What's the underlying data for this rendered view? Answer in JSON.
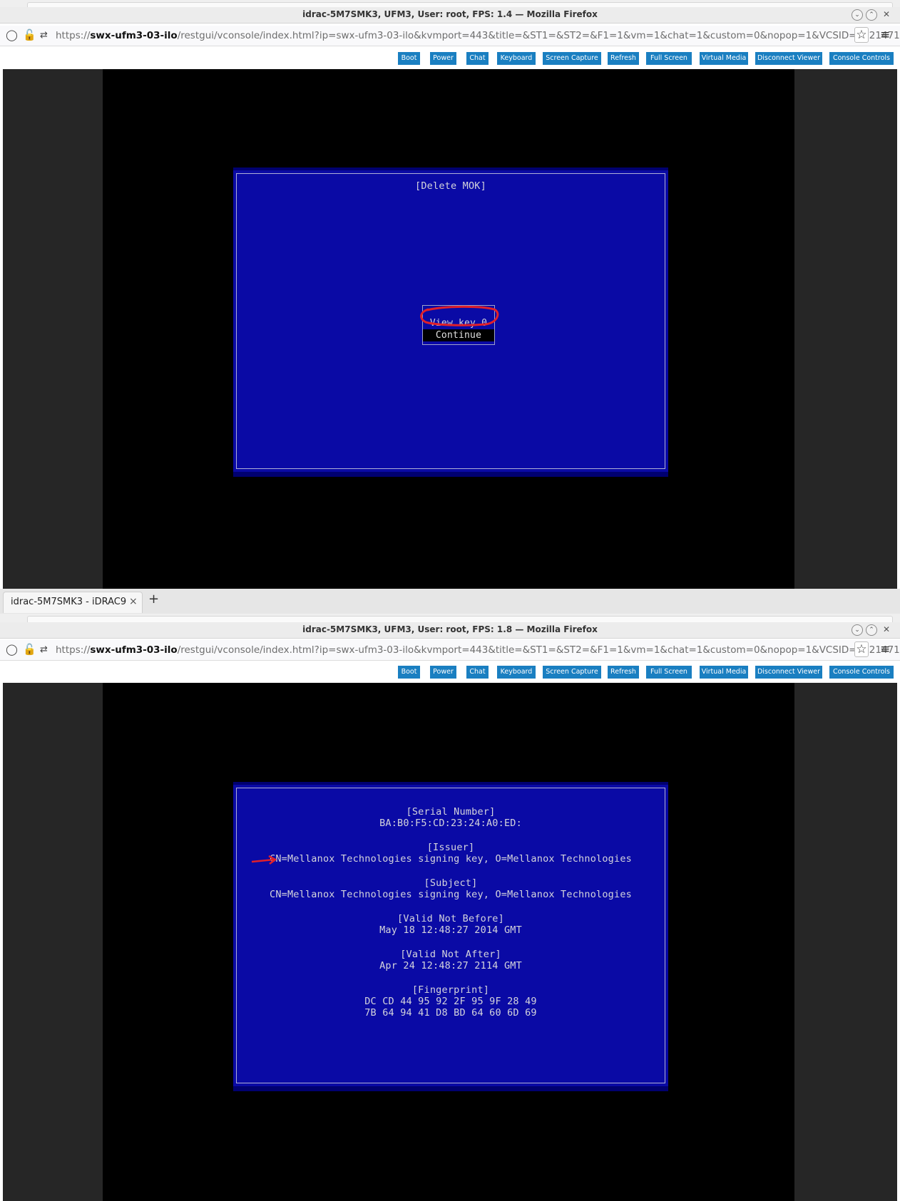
{
  "browser": {
    "tab": {
      "label": "idrac-5M7SMK3 - iDRAC9",
      "close": "×",
      "new_tab": "+"
    },
    "url": {
      "prefix": "https://",
      "domain": "swx-ufm3-03-ilo",
      "path": "/restgui/vconsole/index.html?ip=swx-ufm3-03-ilo&kvmport=443&title=&ST1=&ST2=&F1=1&vm=1&chat=1&custom=0&nopop=1&VCSID=252147116087("
    }
  },
  "windows": [
    {
      "title": "idrac-5M7SMK3, UFM3, User: root, FPS: 1.4 — Mozilla Firefox"
    },
    {
      "title": "idrac-5M7SMK3, UFM3, User: root, FPS: 1.8 — Mozilla Firefox"
    }
  ],
  "toolbar": {
    "buttons": [
      "Boot",
      "Power",
      "Chat",
      "Keyboard",
      "Screen Capture",
      "Refresh",
      "Full Screen",
      "Virtual Media",
      "Disconnect Viewer",
      "Console Controls"
    ]
  },
  "mok_menu": {
    "title": "[Delete MOK]",
    "items": [
      "View key 0",
      "Continue"
    ],
    "selected_index": 1,
    "annotation": "red-circle-around-view-key-0"
  },
  "certificate": {
    "serial_label": "[Serial Number]",
    "serial_value": "BA:B0:F5:CD:23:24:A0:ED:",
    "issuer_label": "[Issuer]",
    "issuer_value": "CN=Mellanox Technologies signing key, O=Mellanox Technologies",
    "subject_label": "[Subject]",
    "subject_value": "CN=Mellanox Technologies signing key, O=Mellanox Technologies",
    "not_before_label": "[Valid Not Before]",
    "not_before_value": "May 18 12:48:27 2014 GMT",
    "not_after_label": "[Valid Not After]",
    "not_after_value": "Apr 24 12:48:27 2114 GMT",
    "fingerprint_label": "[Fingerprint]",
    "fingerprint_line1": "DC CD 44 95 92 2F 95 9F 28 49",
    "fingerprint_line2": "7B 64 94 41 D8 BD 64 60 6D 69",
    "annotation": "red-arrow-pointing-to-issuer"
  },
  "colors": {
    "toolbar_button": "#1a7fc1",
    "bios_background": "#0a0aa5",
    "bios_text": "#d4d4dc",
    "annotation_red": "#e0202a"
  }
}
